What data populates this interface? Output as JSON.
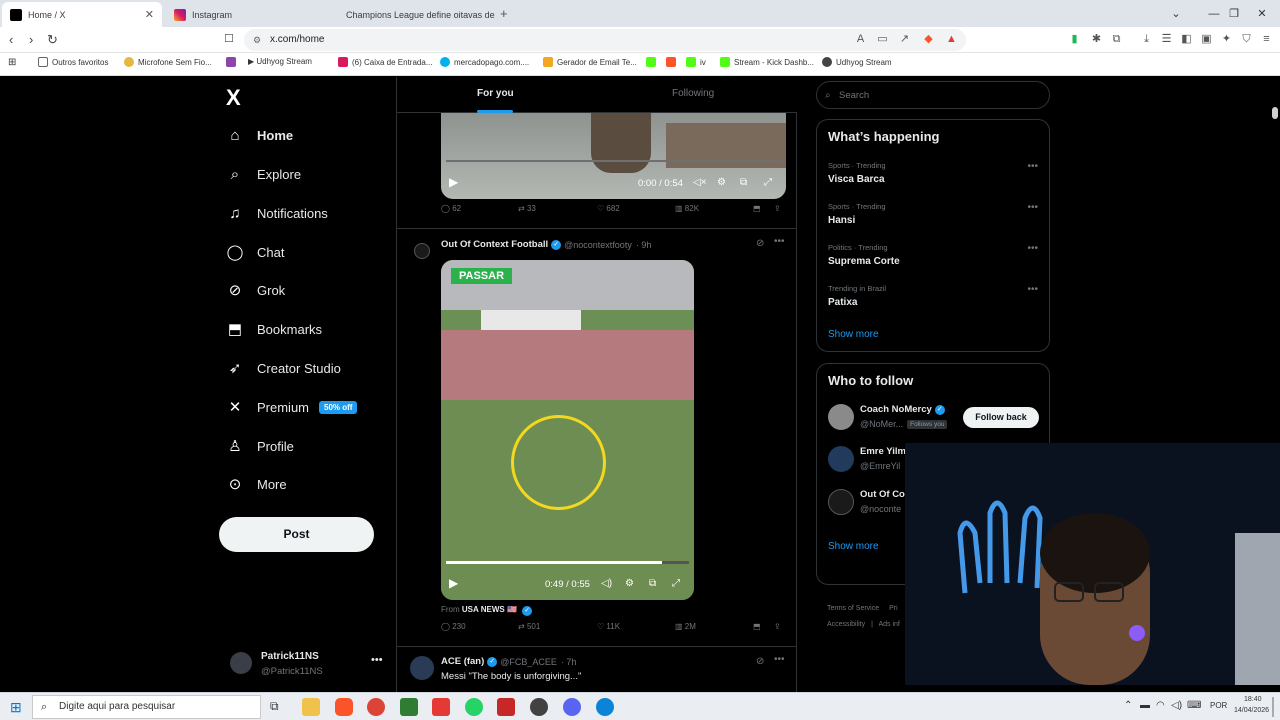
{
  "browser": {
    "tabs": [
      {
        "title": "Home / X",
        "active": true
      },
      {
        "title": "Instagram",
        "active": false
      },
      {
        "title": "Champions League define oitavas de",
        "active": false
      }
    ],
    "url": "x.com/home",
    "bookmarks": [
      "Outros favoritos",
      "Microfone Sem Fio...",
      "▶ Udhyog Stream",
      "(6) Caixa de Entrada...",
      "mercadopago.com....",
      "Gerador de Email Te...",
      "iv",
      "Stream - Kick Dashb...",
      "Udhyog Stream"
    ]
  },
  "sidebar": {
    "logo": "X",
    "items": [
      {
        "label": "Home",
        "icon": "home-icon"
      },
      {
        "label": "Explore",
        "icon": "search-icon"
      },
      {
        "label": "Notifications",
        "icon": "bell-icon"
      },
      {
        "label": "Chat",
        "icon": "chat-icon"
      },
      {
        "label": "Grok",
        "icon": "grok-icon"
      },
      {
        "label": "Bookmarks",
        "icon": "bookmark-icon"
      },
      {
        "label": "Creator Studio",
        "icon": "rocket-icon"
      },
      {
        "label": "Premium",
        "icon": "x-icon"
      },
      {
        "label": "Profile",
        "icon": "person-icon"
      },
      {
        "label": "More",
        "icon": "more-circle-icon"
      }
    ],
    "premium_badge": "50% off",
    "post_button": "Post",
    "account": {
      "name": "Patrick11NS",
      "handle": "@Patrick11NS"
    }
  },
  "feed": {
    "tabs": [
      "For you",
      "Following"
    ],
    "post1": {
      "video_time": "0:00 / 0:54",
      "replies": "62",
      "reposts": "33",
      "likes": "682",
      "views": "82K"
    },
    "post2": {
      "name": "Out Of Context Football",
      "handle": "@nocontextfooty",
      "time": "· 9h",
      "video_label": "PASSAR",
      "video_time": "0:49 / 0:55",
      "video_progress": 0.89,
      "from_prefix": "From",
      "from_source": "USA NEWS 🇺🇸",
      "replies": "230",
      "reposts": "501",
      "likes": "11K",
      "views": "2M"
    },
    "post3": {
      "name": "ACE (fan)",
      "handle": "@FCB_ACEE",
      "time": "· 7h",
      "text": "Messi \"The body is unforgiving...\""
    }
  },
  "right": {
    "search_placeholder": "Search",
    "happening_title": "What’s happening",
    "trends": [
      {
        "meta": "Sports · Trending",
        "value": "Visca Barca"
      },
      {
        "meta": "Sports · Trending",
        "value": "Hansi"
      },
      {
        "meta": "Politics · Trending",
        "value": "Suprema Corte"
      },
      {
        "meta": "Trending in Brazil",
        "value": "Patixa"
      }
    ],
    "show_more": "Show more",
    "who_to_follow_title": "Who to follow",
    "follow": [
      {
        "name": "Coach NoMercy",
        "handle": "@NoMer...",
        "follows_you": "Follows you",
        "button": "Follow back"
      },
      {
        "name": "Emre Yilm",
        "handle": "@EmreYil"
      },
      {
        "name": "Out Of Co",
        "handle": "@noconte"
      }
    ],
    "footer": [
      "Terms of Service",
      "Pri",
      "Accessibility",
      "Ads inf"
    ]
  },
  "taskbar": {
    "search_placeholder": "Digite aqui para pesquisar",
    "lang": "POR",
    "time": "18:40",
    "date": "14/04/2026"
  },
  "colors": {
    "accent": "#1d9bf0",
    "background": "#000000",
    "border": "#2f3336"
  }
}
